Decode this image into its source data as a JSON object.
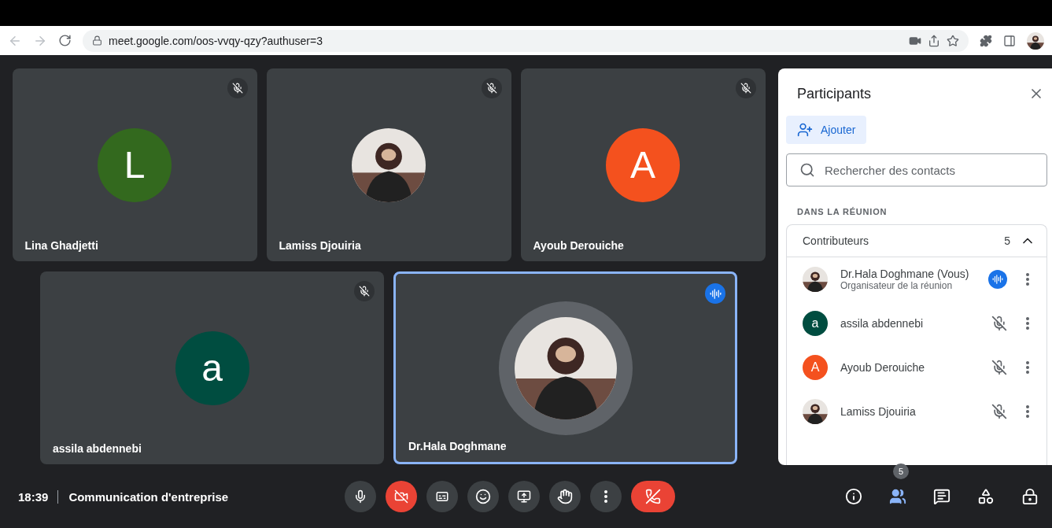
{
  "browser": {
    "url": "meet.google.com/oos-vvqy-qzy?authuser=3"
  },
  "tiles": [
    {
      "name": "Lina Ghadjetti",
      "avatar": {
        "kind": "letter",
        "letter": "L",
        "color": "#33691e"
      },
      "muted": true,
      "speaking": false
    },
    {
      "name": "Lamiss Djouiria",
      "muted": true,
      "speaking": false
    },
    {
      "name": "Ayoub Derouiche",
      "avatar": {
        "kind": "letter",
        "letter": "A",
        "color": "#f4511e"
      },
      "muted": true,
      "speaking": false
    },
    {
      "name": "assila abdennebi",
      "avatar": {
        "kind": "letter",
        "letter": "a",
        "color": "#004d40"
      },
      "muted": true,
      "speaking": false
    },
    {
      "name": "Dr.Hala Doghmane",
      "muted": false,
      "speaking": true
    }
  ],
  "panel": {
    "title": "Participants",
    "add_button": "Ajouter",
    "search": {
      "placeholder": "Rechercher des contacts"
    },
    "section": "DANS LA RÉUNION",
    "group": {
      "label": "Contributeurs",
      "count": "5",
      "expanded": true
    },
    "participants": [
      {
        "name": "Dr.Hala Doghmane (Vous)",
        "role": "Organisateur de la réunion",
        "speaking": true
      },
      {
        "name": "assila abdennebi",
        "avatar": {
          "kind": "letter",
          "letter": "a",
          "color": "#004d40"
        },
        "muted": true,
        "speaking": false
      },
      {
        "name": "Ayoub Derouiche",
        "avatar": {
          "kind": "letter",
          "letter": "A",
          "color": "#f4511e"
        },
        "muted": true,
        "speaking": false
      },
      {
        "name": "Lamiss Djouiria",
        "muted": true,
        "speaking": false
      }
    ]
  },
  "bottom_bar": {
    "time": "18:39",
    "meeting_title": "Communication d'entreprise",
    "controls": [
      {
        "kind": "mic",
        "off": false
      },
      {
        "kind": "camera",
        "off": true
      },
      {
        "kind": "captions",
        "off": false
      },
      {
        "kind": "emoji",
        "off": false
      },
      {
        "kind": "present",
        "off": false
      },
      {
        "kind": "hand",
        "off": false
      },
      {
        "kind": "more",
        "off": false
      },
      {
        "kind": "end"
      }
    ],
    "side": [
      {
        "kind": "info",
        "selected": false
      },
      {
        "kind": "people",
        "selected": true,
        "badge": "5"
      },
      {
        "kind": "chat",
        "selected": false
      },
      {
        "kind": "activities",
        "selected": false
      },
      {
        "kind": "host",
        "selected": false
      }
    ]
  }
}
